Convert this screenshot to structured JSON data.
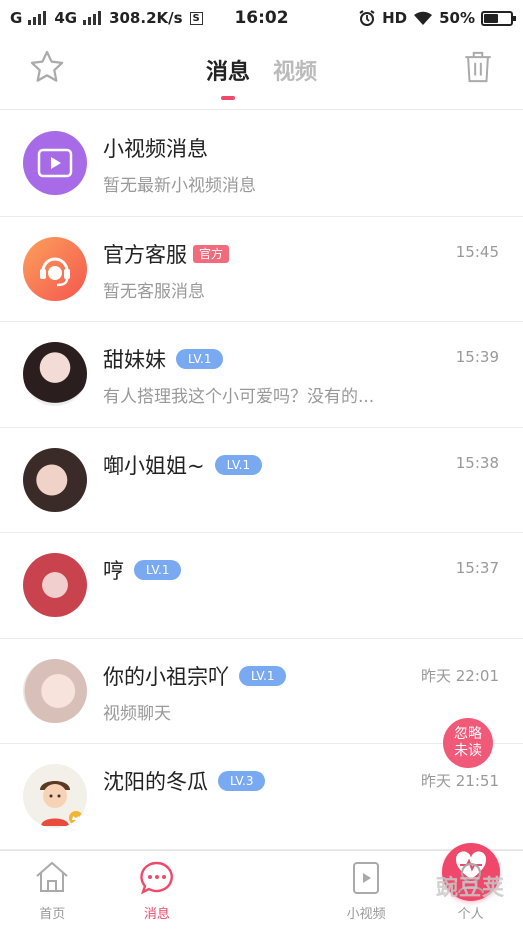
{
  "status_bar": {
    "carrier1": "G",
    "carrier2": "4G",
    "speed": "308.2K/s",
    "speed_box": "S",
    "time": "16:02",
    "hd": "HD",
    "battery": "50%",
    "battery_level": 0.5
  },
  "header": {
    "tabs": [
      {
        "label": "消息",
        "active": true
      },
      {
        "label": "视频",
        "active": false
      }
    ],
    "icons": {
      "left": "star-icon",
      "right": "trash-icon"
    }
  },
  "messages": [
    {
      "name": "小视频消息",
      "badge": "",
      "time": "",
      "preview": "暂无最新小视频消息",
      "avatar": "video-play-icon",
      "avatar_color": "#a86be8"
    },
    {
      "name": "官方客服",
      "badge": "官方",
      "time": "15:45",
      "preview": "暂无客服消息",
      "avatar": "headset-icon",
      "avatar_color": "#f97a4a"
    },
    {
      "name": "甜妹妹",
      "badge": "LV.1",
      "time": "15:39",
      "preview": "有人搭理我这个小可爱吗？没有的...",
      "avatar": "user-photo",
      "avatar_color": "#d9c1c4"
    },
    {
      "name": "啣小姐姐~",
      "badge": "LV.1",
      "time": "15:38",
      "preview": "",
      "avatar": "user-photo",
      "avatar_color": "#c9a7a2"
    },
    {
      "name": "哼",
      "badge": "LV.1",
      "time": "15:37",
      "preview": "",
      "avatar": "user-photo",
      "avatar_color": "#c9626f"
    },
    {
      "name": "你的小祖宗吖",
      "badge": "LV.1",
      "time": "昨天 22:01",
      "preview": "视频聊天",
      "avatar": "user-photo",
      "avatar_color": "#e6d5d0"
    },
    {
      "name": "沈阳的冬瓜",
      "badge": "LV.3",
      "time": "昨天 21:51",
      "preview": "",
      "avatar": "cartoon-avatar",
      "avatar_color": "#f3efe9"
    }
  ],
  "ignore_unread": "忽略\n未读",
  "bottom_nav": {
    "items": [
      {
        "label": "首页",
        "icon": "home-icon"
      },
      {
        "label": "消息",
        "icon": "chat-icon",
        "active": true
      },
      {
        "label": "",
        "icon": "heart-pulse-icon"
      },
      {
        "label": "小视频",
        "icon": "video-icon"
      },
      {
        "label": "个人",
        "icon": "person-icon"
      }
    ]
  },
  "watermark": "豌豆荚",
  "colors": {
    "accent": "#f04a6a",
    "badge_lv": "#79a9f0",
    "badge_official": "#f26b7d"
  }
}
